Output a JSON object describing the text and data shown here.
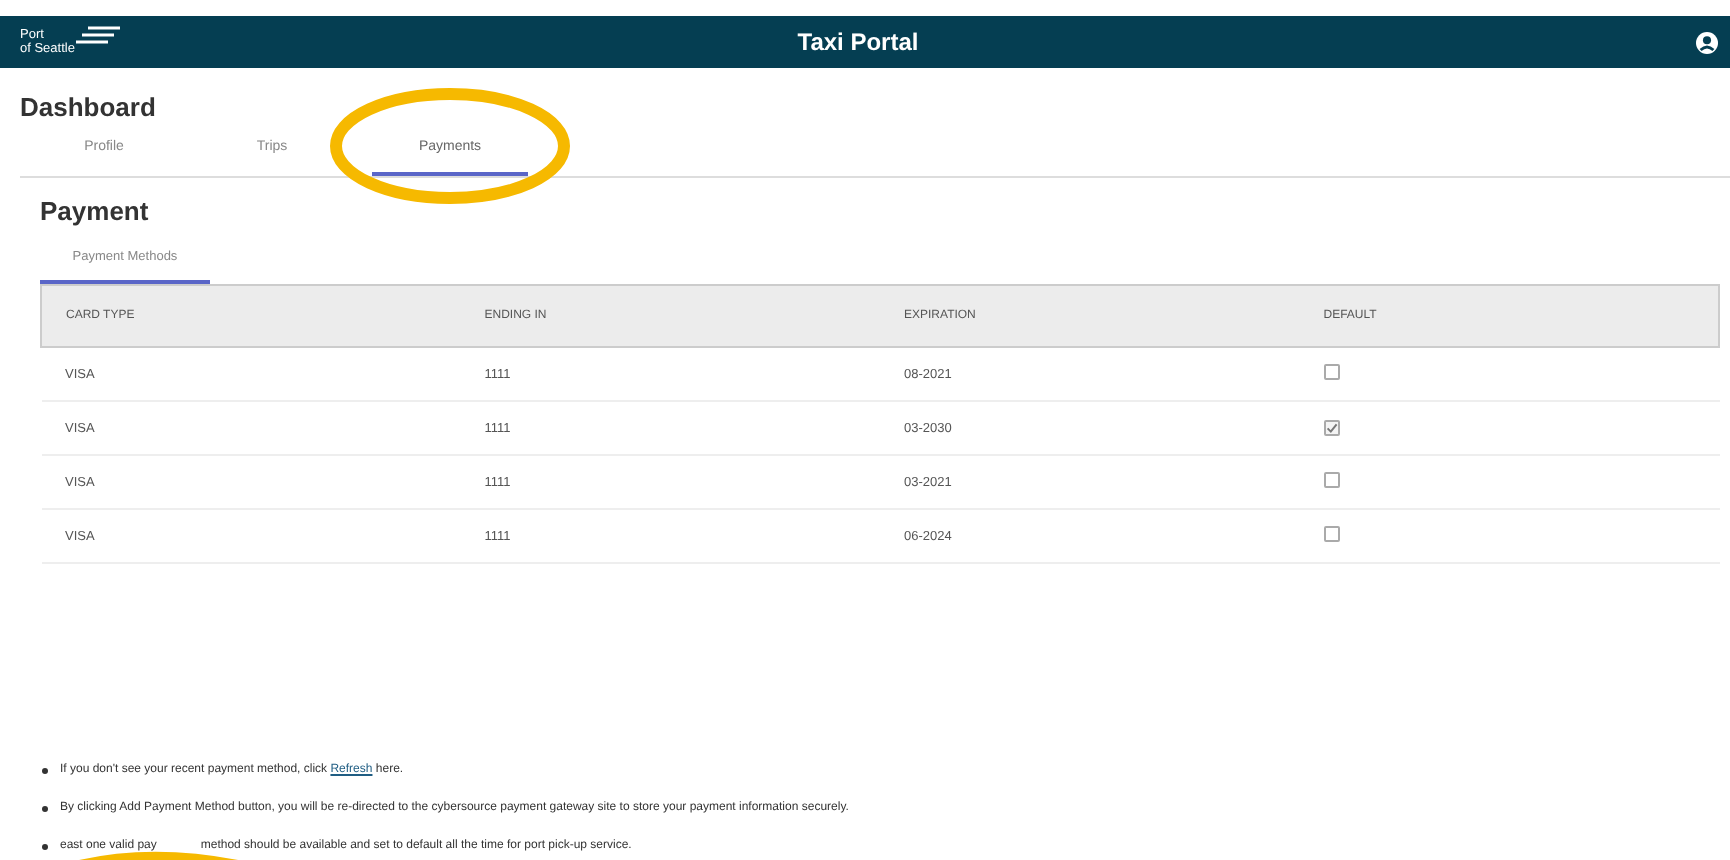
{
  "header": {
    "logo_line1": "Port",
    "logo_line2": "of Seattle",
    "title": "Taxi Portal"
  },
  "page_title": "Dashboard",
  "tabs": [
    {
      "label": "Profile",
      "selected": false
    },
    {
      "label": "Trips",
      "selected": false
    },
    {
      "label": "Payments",
      "selected": true
    }
  ],
  "section_title": "Payment",
  "subtabs": [
    {
      "label": "Payment Methods",
      "selected": true
    }
  ],
  "table": {
    "columns": [
      "CARD TYPE",
      "ENDING IN",
      "EXPIRATION",
      "DEFAULT"
    ],
    "rows": [
      {
        "card_type": "VISA",
        "ending_in": "1111",
        "expiration": "08-2021",
        "default": false
      },
      {
        "card_type": "VISA",
        "ending_in": "1111",
        "expiration": "03-2030",
        "default": true
      },
      {
        "card_type": "VISA",
        "ending_in": "1111",
        "expiration": "03-2021",
        "default": false
      },
      {
        "card_type": "VISA",
        "ending_in": "1111",
        "expiration": "06-2024",
        "default": false
      }
    ]
  },
  "notes": [
    {
      "before": "If you don't see your recent payment method, click ",
      "link": "Refresh",
      "after": " here."
    },
    {
      "before": "By clicking Add Payment Method button, you will be re-directed to the cybersource payment gateway site to store your payment information securely."
    },
    {
      "before": "east one valid pay",
      "covered_after": "method should be available and set to default all the time for port pick-up service."
    }
  ]
}
